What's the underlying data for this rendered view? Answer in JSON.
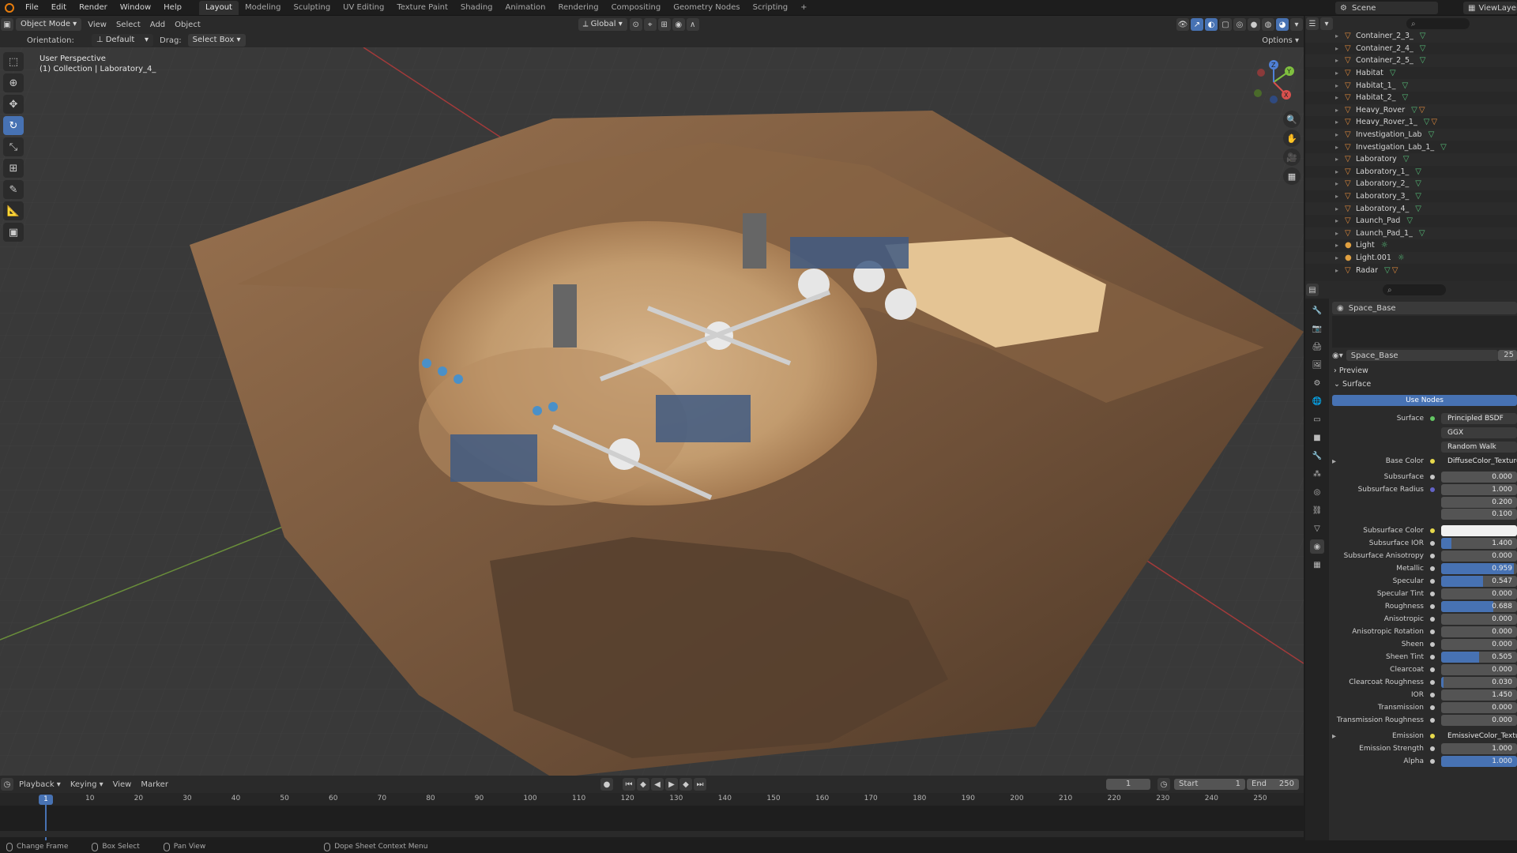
{
  "topbar": {
    "menus": [
      "File",
      "Edit",
      "Render",
      "Window",
      "Help"
    ],
    "workspaces": [
      "Layout",
      "Modeling",
      "Sculpting",
      "UV Editing",
      "Texture Paint",
      "Shading",
      "Animation",
      "Rendering",
      "Compositing",
      "Geometry Nodes",
      "Scripting"
    ],
    "active_workspace": "Layout",
    "add_tab": "+",
    "scene": "Scene",
    "view_layer": "ViewLayer"
  },
  "viewport_header": {
    "mode": "Object Mode",
    "menus": [
      "View",
      "Select",
      "Add",
      "Object"
    ],
    "transform": "Global",
    "orientation_label": "Orientation:",
    "orientation_value": "Default",
    "drag_label": "Drag:",
    "drag_value": "Select Box",
    "options": "Options"
  },
  "viewport_info": {
    "perspective": "User Perspective",
    "collection": "(1) Collection | Laboratory_4_"
  },
  "outliner": {
    "items": [
      {
        "name": "Container_2_3_",
        "type": "object"
      },
      {
        "name": "Container_2_4_",
        "type": "object"
      },
      {
        "name": "Container_2_5_",
        "type": "object"
      },
      {
        "name": "Habitat",
        "type": "object"
      },
      {
        "name": "Habitat_1_",
        "type": "object"
      },
      {
        "name": "Habitat_2_",
        "type": "object"
      },
      {
        "name": "Heavy_Rover",
        "type": "object"
      },
      {
        "name": "Heavy_Rover_1_",
        "type": "object"
      },
      {
        "name": "Investigation_Lab",
        "type": "object"
      },
      {
        "name": "Investigation_Lab_1_",
        "type": "object"
      },
      {
        "name": "Laboratory",
        "type": "object"
      },
      {
        "name": "Laboratory_1_",
        "type": "object"
      },
      {
        "name": "Laboratory_2_",
        "type": "object"
      },
      {
        "name": "Laboratory_3_",
        "type": "object"
      },
      {
        "name": "Laboratory_4_",
        "type": "object"
      },
      {
        "name": "Launch_Pad",
        "type": "object"
      },
      {
        "name": "Launch_Pad_1_",
        "type": "object"
      },
      {
        "name": "Light",
        "type": "light"
      },
      {
        "name": "Light.001",
        "type": "light"
      },
      {
        "name": "Radar",
        "type": "object"
      }
    ]
  },
  "properties": {
    "object_name": "Space_Base",
    "material_name": "Space_Base",
    "material_users": "25",
    "preview_label": "Preview",
    "surface_section": "Surface",
    "use_nodes": "Use Nodes",
    "surface_label": "Surface",
    "surface_shader": "Principled BSDF",
    "distribution": "GGX",
    "subsurface_method": "Random Walk",
    "base_color_label": "Base Color",
    "base_color_value": "DiffuseColor_Texture",
    "rows": [
      {
        "label": "Subsurface",
        "value": "0.000",
        "fill": 0
      },
      {
        "label": "Subsurface Radius",
        "value": "1.000",
        "fill": 0
      },
      {
        "label": "",
        "value": "0.200",
        "fill": 0
      },
      {
        "label": "",
        "value": "0.100",
        "fill": 0
      },
      {
        "label": "Subsurface Color",
        "value": "",
        "fill": 0
      },
      {
        "label": "Subsurface IOR",
        "value": "1.400",
        "fill": 0.14
      },
      {
        "label": "Subsurface Anisotropy",
        "value": "0.000",
        "fill": 0
      },
      {
        "label": "Metallic",
        "value": "0.959",
        "fill": 0.959
      },
      {
        "label": "Specular",
        "value": "0.547",
        "fill": 0.547
      },
      {
        "label": "Specular Tint",
        "value": "0.000",
        "fill": 0
      },
      {
        "label": "Roughness",
        "value": "0.688",
        "fill": 0.688
      },
      {
        "label": "Anisotropic",
        "value": "0.000",
        "fill": 0
      },
      {
        "label": "Anisotropic Rotation",
        "value": "0.000",
        "fill": 0
      },
      {
        "label": "Sheen",
        "value": "0.000",
        "fill": 0
      },
      {
        "label": "Sheen Tint",
        "value": "0.505",
        "fill": 0.505
      },
      {
        "label": "Clearcoat",
        "value": "0.000",
        "fill": 0
      },
      {
        "label": "Clearcoat Roughness",
        "value": "0.030",
        "fill": 0.03
      },
      {
        "label": "IOR",
        "value": "1.450",
        "fill": 0
      },
      {
        "label": "Transmission",
        "value": "0.000",
        "fill": 0
      },
      {
        "label": "Transmission Roughness",
        "value": "0.000",
        "fill": 0
      },
      {
        "label": "Emission",
        "value": "EmissiveColor_Texture",
        "fill": 0
      },
      {
        "label": "Emission Strength",
        "value": "1.000",
        "fill": 0
      },
      {
        "label": "Alpha",
        "value": "1.000",
        "fill": 1
      }
    ]
  },
  "timeline": {
    "menus": [
      "Playback",
      "Keying",
      "View",
      "Marker"
    ],
    "current_frame": "1",
    "start_label": "Start",
    "start": "1",
    "end_label": "End",
    "end": "250",
    "ticks": [
      "10",
      "20",
      "30",
      "40",
      "50",
      "60",
      "70",
      "80",
      "90",
      "100",
      "110",
      "120",
      "130",
      "140",
      "150",
      "160",
      "170",
      "180",
      "190",
      "200",
      "210",
      "220",
      "230",
      "240",
      "250"
    ],
    "playhead": "1"
  },
  "statusbar": {
    "items": [
      "Change Frame",
      "Box Select",
      "Pan View",
      "Dope Sheet Context Menu"
    ]
  },
  "colors": {
    "accent": "#4772b3",
    "object_icon": "#e08a3c",
    "mesh_data": "#55bb77",
    "terrain_light": "#c49a6c",
    "terrain_dark": "#5a4230",
    "grid": "#393939"
  }
}
